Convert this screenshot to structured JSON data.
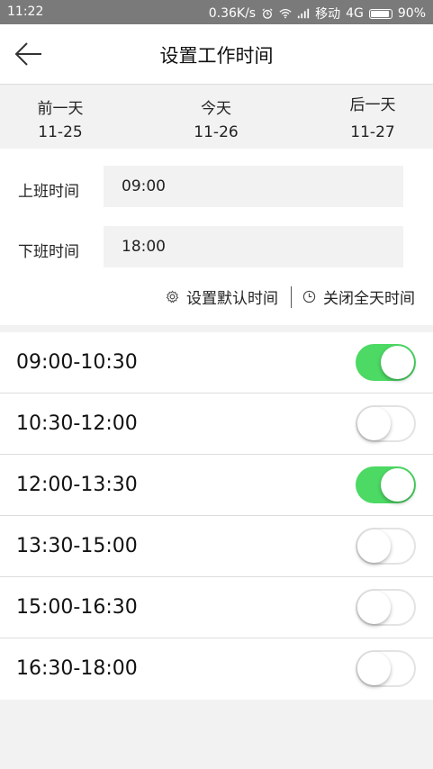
{
  "status_bar": {
    "time": "11:22",
    "net_speed": "0.36K/s",
    "carrier": "移动",
    "network": "4G",
    "battery": "90%"
  },
  "header": {
    "title": "设置工作时间"
  },
  "days": [
    {
      "label": "前一天",
      "date": "11-25"
    },
    {
      "label": "今天",
      "date": "11-26"
    },
    {
      "label": "后一天",
      "date": "11-27"
    }
  ],
  "work_time": {
    "start_label": "上班时间",
    "start_value": "09:00",
    "end_label": "下班时间",
    "end_value": "18:00",
    "set_default_label": "设置默认时间",
    "close_all_label": "关闭全天时间"
  },
  "slots": [
    {
      "range": "09:00-10:30",
      "enabled": true
    },
    {
      "range": "10:30-12:00",
      "enabled": false
    },
    {
      "range": "12:00-13:30",
      "enabled": true
    },
    {
      "range": "13:30-15:00",
      "enabled": false
    },
    {
      "range": "15:00-16:30",
      "enabled": false
    },
    {
      "range": "16:30-18:00",
      "enabled": false
    }
  ],
  "colors": {
    "toggle_on": "#4cd964",
    "status_bar": "#7a7a7a"
  },
  "icons": [
    "back-arrow-icon",
    "gear-icon",
    "clock-icon",
    "alarm-icon",
    "wifi-icon",
    "signal-icon",
    "battery-icon"
  ]
}
